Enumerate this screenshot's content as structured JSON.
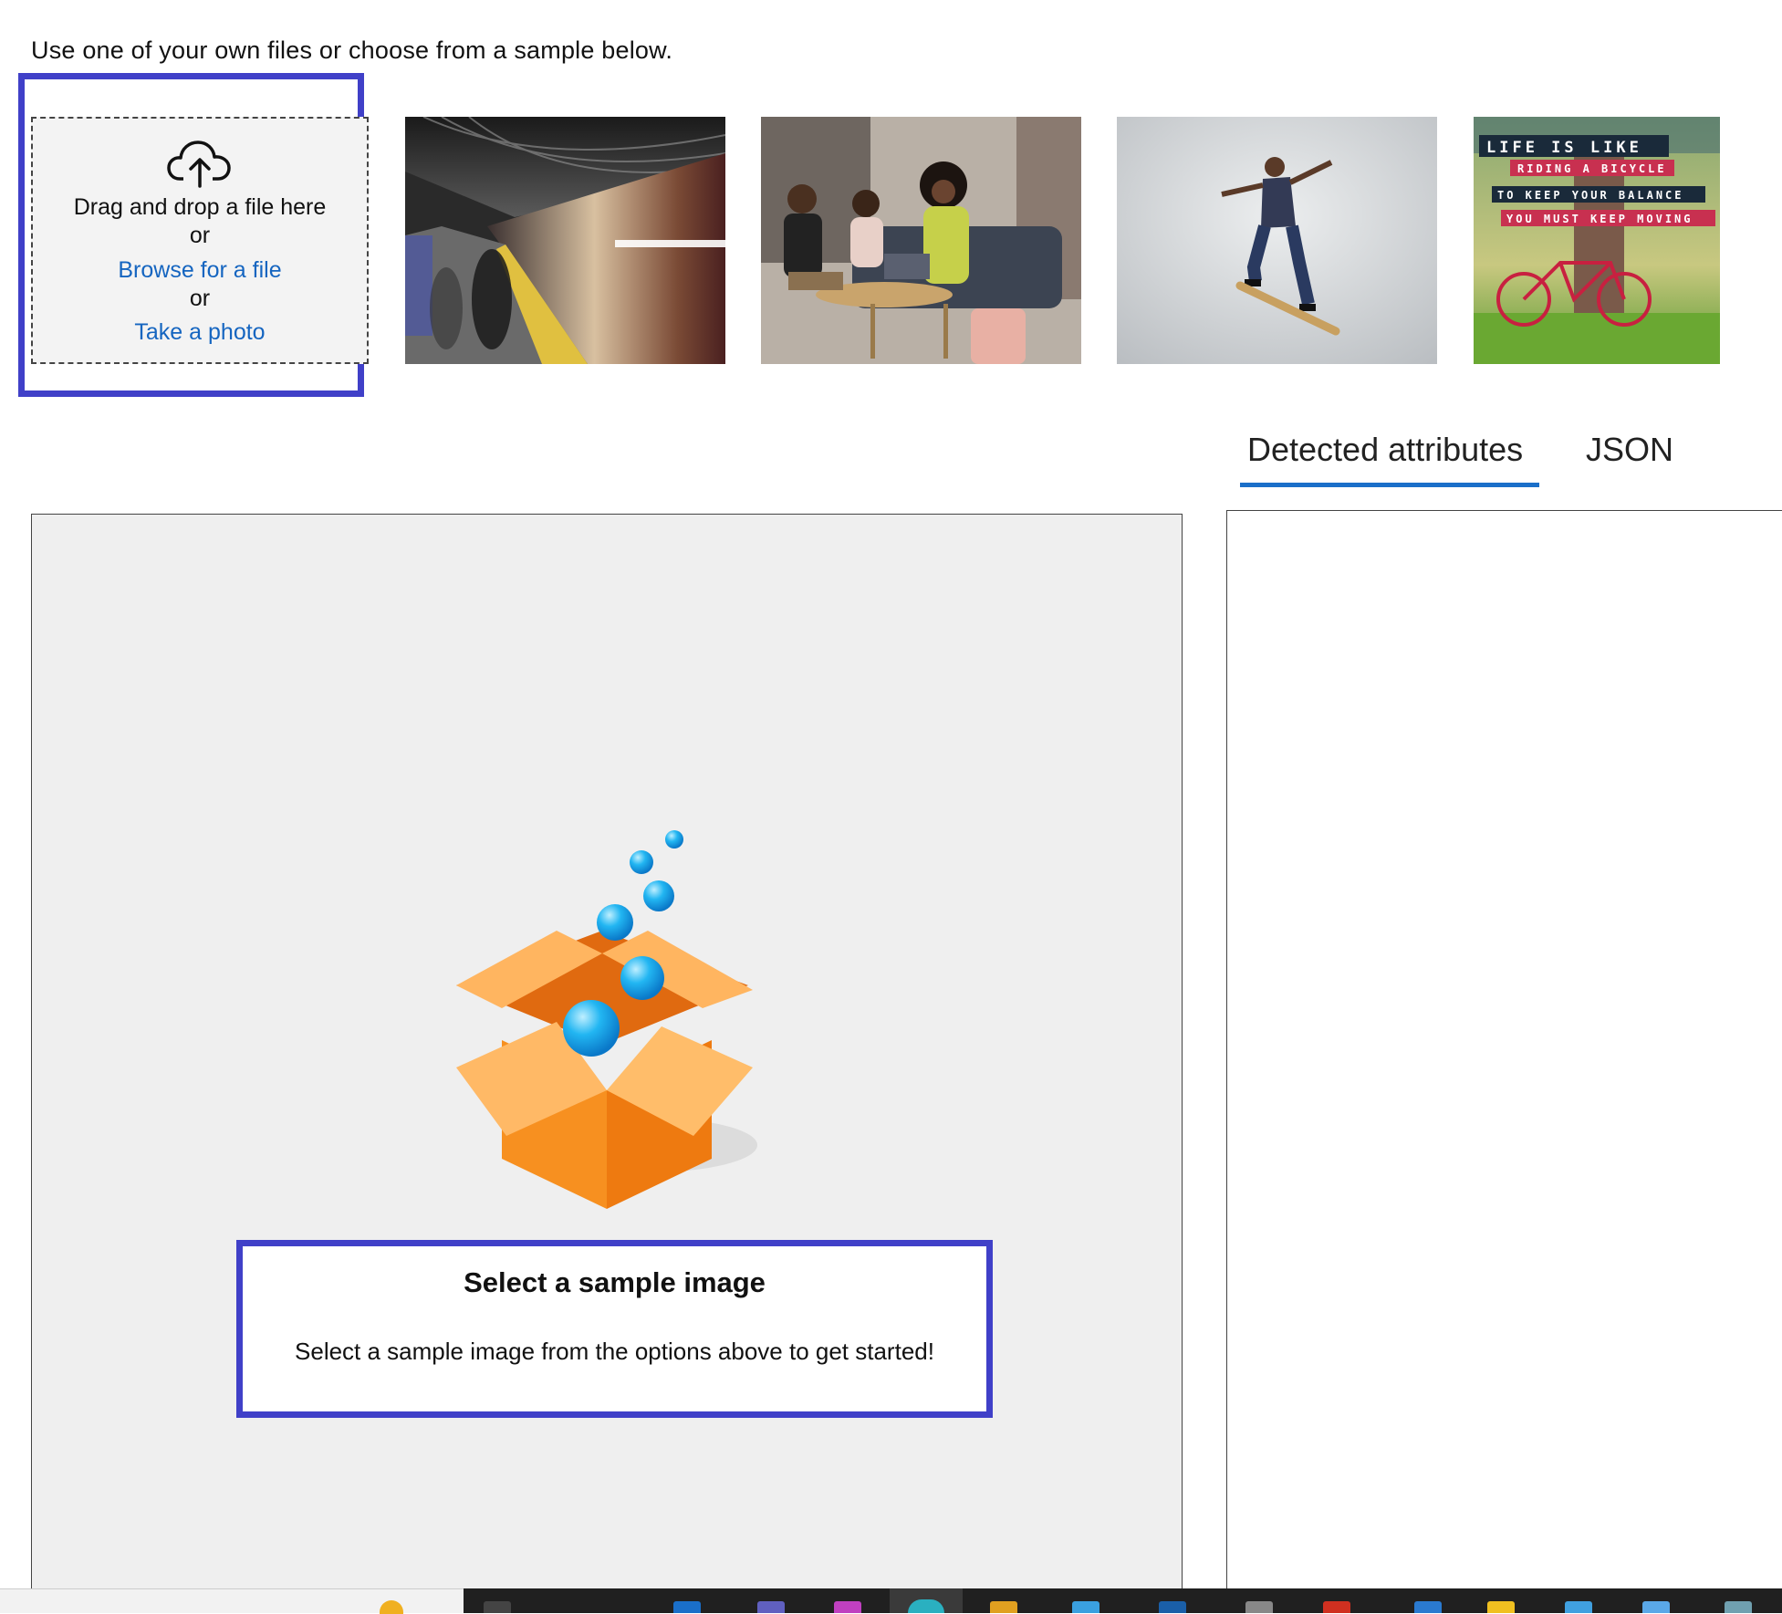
{
  "instruction": "Use one of your own files or choose from a sample below.",
  "upload": {
    "drag_text": "Drag and drop a file here",
    "or_1": "or",
    "browse_label": "Browse for a file",
    "or_2": "or",
    "photo_label": "Take a photo",
    "icon": "cloud-upload-icon"
  },
  "samples": [
    {
      "name": "subway-train-sample",
      "alt": ""
    },
    {
      "name": "office-meeting-sample",
      "alt": ""
    },
    {
      "name": "skateboarder-sample",
      "alt": ""
    },
    {
      "name": "bicycle-quote-sample",
      "alt": "",
      "lines": [
        "LIFE IS LIKE",
        "RIDING A BICYCLE",
        "TO KEEP YOUR BALANCE",
        "YOU MUST KEEP MOVING"
      ]
    }
  ],
  "tabs": [
    {
      "label": "Detected attributes",
      "active": true
    },
    {
      "label": "JSON",
      "active": false
    }
  ],
  "empty_state": {
    "title": "Select a sample image",
    "body": "Select a sample image from the options above to get started!",
    "icon": "open-box-icon"
  },
  "colors": {
    "highlight": "#4040c8",
    "link": "#1565c0",
    "tab_underline": "#1a6fc9"
  }
}
